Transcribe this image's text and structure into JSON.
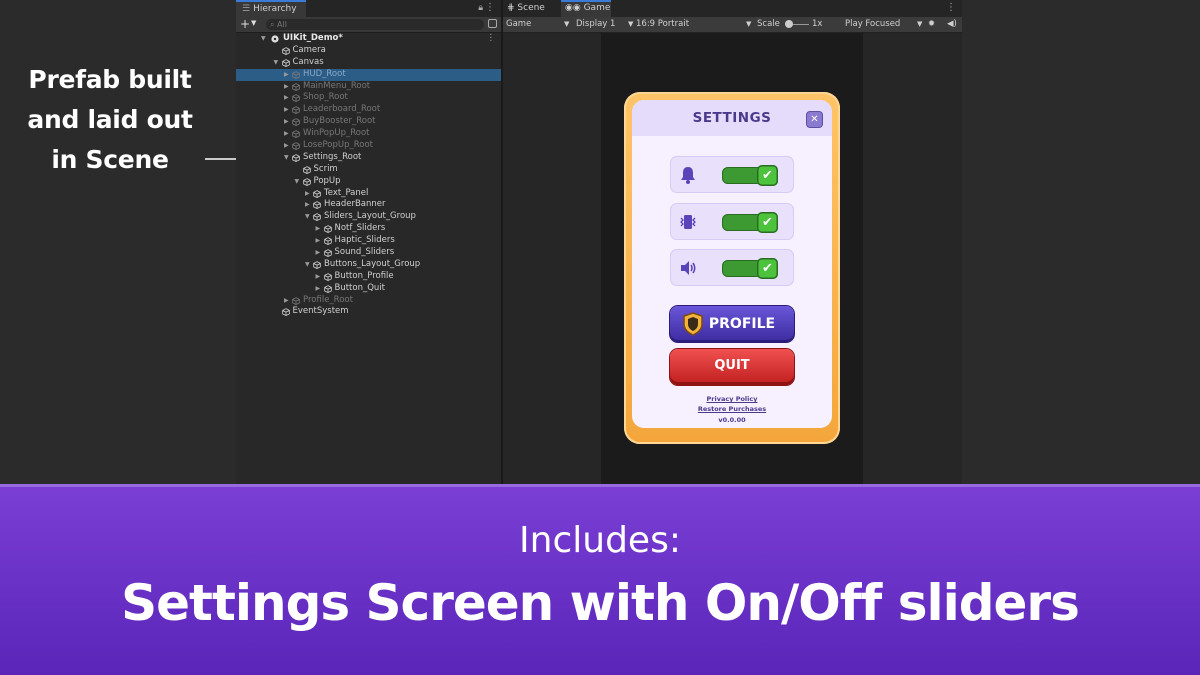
{
  "annotation": {
    "lines": [
      "Prefab built",
      "and laid out",
      "in Scene"
    ]
  },
  "hierarchy": {
    "tab_label": "Hierarchy",
    "search_placeholder": "All",
    "scene_name": "UIKit_Demo*",
    "items": [
      {
        "label": "Camera",
        "depth": 1,
        "dim": false,
        "arrow": ""
      },
      {
        "label": "Canvas",
        "depth": 1,
        "dim": false,
        "arrow": "open"
      },
      {
        "label": "HUD_Root",
        "depth": 2,
        "dim": true,
        "arrow": "closed",
        "selected": true
      },
      {
        "label": "MainMenu_Root",
        "depth": 2,
        "dim": true,
        "arrow": "closed"
      },
      {
        "label": "Shop_Root",
        "depth": 2,
        "dim": true,
        "arrow": "closed"
      },
      {
        "label": "Leaderboard_Root",
        "depth": 2,
        "dim": true,
        "arrow": "closed"
      },
      {
        "label": "BuyBooster_Root",
        "depth": 2,
        "dim": true,
        "arrow": "closed"
      },
      {
        "label": "WinPopUp_Root",
        "depth": 2,
        "dim": true,
        "arrow": "closed"
      },
      {
        "label": "LosePopUp_Root",
        "depth": 2,
        "dim": true,
        "arrow": "closed"
      },
      {
        "label": "Settings_Root",
        "depth": 2,
        "dim": false,
        "arrow": "open"
      },
      {
        "label": "Scrim",
        "depth": 3,
        "dim": false,
        "arrow": ""
      },
      {
        "label": "PopUp",
        "depth": 3,
        "dim": false,
        "arrow": "open"
      },
      {
        "label": "Text_Panel",
        "depth": 4,
        "dim": false,
        "arrow": "closed"
      },
      {
        "label": "HeaderBanner",
        "depth": 4,
        "dim": false,
        "arrow": "closed"
      },
      {
        "label": "Sliders_Layout_Group",
        "depth": 4,
        "dim": false,
        "arrow": "open"
      },
      {
        "label": "Notf_Sliders",
        "depth": 5,
        "dim": false,
        "arrow": "closed"
      },
      {
        "label": "Haptic_Sliders",
        "depth": 5,
        "dim": false,
        "arrow": "closed"
      },
      {
        "label": "Sound_Sliders",
        "depth": 5,
        "dim": false,
        "arrow": "closed"
      },
      {
        "label": "Buttons_Layout_Group",
        "depth": 4,
        "dim": false,
        "arrow": "open"
      },
      {
        "label": "Button_Profile",
        "depth": 5,
        "dim": false,
        "arrow": "closed"
      },
      {
        "label": "Button_Quit",
        "depth": 5,
        "dim": false,
        "arrow": "closed"
      },
      {
        "label": "Profile_Root",
        "depth": 2,
        "dim": true,
        "arrow": "closed"
      },
      {
        "label": "EventSystem",
        "depth": 1,
        "dim": false,
        "arrow": ""
      }
    ]
  },
  "game_view": {
    "tabs": [
      "Scene",
      "Game"
    ],
    "toolbar": {
      "mode": "Game",
      "display": "Display 1",
      "aspect": "16:9 Portrait",
      "scale_label": "Scale",
      "scale_value": "1x",
      "play_mode": "Play Focused"
    }
  },
  "settings_popup": {
    "title": "SETTINGS",
    "close_glyph": "✕",
    "toggles": [
      {
        "icon": "bell-icon",
        "on": true
      },
      {
        "icon": "vibration-icon",
        "on": true
      },
      {
        "icon": "speaker-icon",
        "on": true
      }
    ],
    "check_glyph": "✔",
    "profile_label": "PROFILE",
    "quit_label": "QUIT",
    "privacy_link": "Privacy Policy",
    "restore_link": "Restore Purchases",
    "version": "v0.0.00"
  },
  "banner": {
    "includes": "Includes:",
    "headline": "Settings Screen with On/Off sliders"
  },
  "colors": {
    "banner": "#6a30c8",
    "toggle_on": "#4cc23d",
    "profile_button": "#5040c0",
    "quit_button": "#d83232",
    "popup_frame": "#f7b04a"
  }
}
